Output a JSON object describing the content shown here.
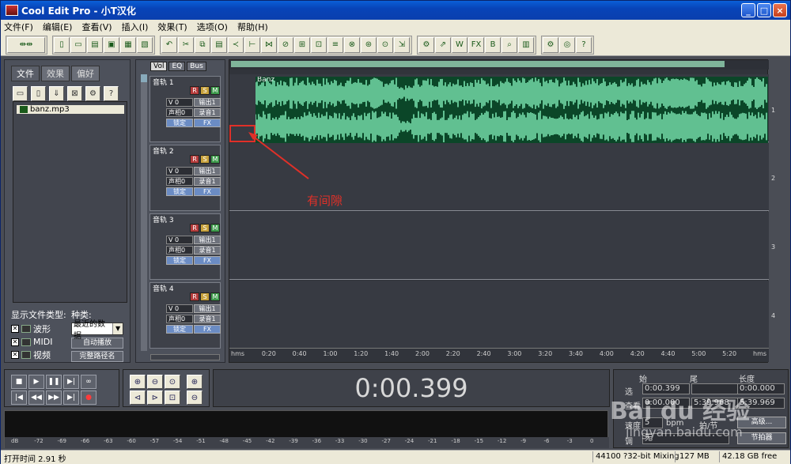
{
  "window": {
    "title": "Cool Edit Pro   - 小T汉化",
    "minimize": "_",
    "maximize": "□",
    "close": "×"
  },
  "menu": [
    "文件(F)",
    "编辑(E)",
    "查看(V)",
    "插入(I)",
    "效果(T)",
    "选项(O)",
    "帮助(H)"
  ],
  "left_panel": {
    "tabs": [
      "文件",
      "效果",
      "偏好"
    ],
    "files": [
      "banz.mp3"
    ],
    "file_type_label": "显示文件类型:",
    "types": [
      {
        "label": "波形",
        "checked": true
      },
      {
        "label": "MIDI",
        "checked": true
      },
      {
        "label": "视频",
        "checked": true
      }
    ],
    "kind_label": "种类:",
    "kind_value": "最近的数据",
    "auto_play": "自动播放",
    "full_path": "完整路径名"
  },
  "track_panel": {
    "tabs": [
      "Vol",
      "EQ",
      "Bus"
    ],
    "tracks": [
      {
        "name": "音轨 1",
        "vol": "V 0",
        "pan": "声相0",
        "out": "输出1",
        "rec": "录音1",
        "lock": "锁定",
        "fx": "FX"
      },
      {
        "name": "音轨 2",
        "vol": "V 0",
        "pan": "声相0",
        "out": "输出1",
        "rec": "录音1",
        "lock": "锁定",
        "fx": "FX"
      },
      {
        "name": "音轨 3",
        "vol": "V 0",
        "pan": "声相0",
        "out": "输出1",
        "rec": "录音1",
        "lock": "锁定",
        "fx": "FX"
      },
      {
        "name": "音轨 4",
        "vol": "V 0",
        "pan": "声相0",
        "out": "输出1",
        "rec": "录音1",
        "lock": "锁定",
        "fx": "FX"
      }
    ],
    "rsm": [
      "R",
      "S",
      "M"
    ]
  },
  "wave": {
    "clip_name": "Banz",
    "annotation": "有间隙",
    "timeline": [
      "hms",
      "0:20",
      "0:40",
      "1:00",
      "1:20",
      "1:40",
      "2:00",
      "2:20",
      "2:40",
      "3:00",
      "3:20",
      "3:40",
      "4:00",
      "4:20",
      "4:40",
      "5:00",
      "5:20",
      "hms"
    ],
    "track_numbers": [
      "1",
      "2",
      "3",
      "4"
    ]
  },
  "time_display": "0:00.399",
  "selection": {
    "header_start": "始",
    "header_end": "尾",
    "header_length": "长度",
    "row_sel": "选",
    "row_view": "查看",
    "sel_start": "0:00.399",
    "sel_end": "",
    "sel_length": "0:00.000",
    "view_start": "0:00.000",
    "view_end": "5:39.968",
    "view_length": "5:39.969",
    "advanced": "高级...",
    "tempo_label": "速度",
    "tempo_value": "5",
    "bpm": "bpm",
    "beat_label": "拍/节",
    "key_label": "调",
    "key_value": "无",
    "rhythm": "节拍器"
  },
  "level_meter": {
    "ticks": [
      "dB",
      "-72",
      "-69",
      "-66",
      "-63",
      "-60",
      "-57",
      "-54",
      "-51",
      "-48",
      "-45",
      "-42",
      "-39",
      "-36",
      "-33",
      "-30",
      "-27",
      "-24",
      "-21",
      "-18",
      "-15",
      "-12",
      "-9",
      "-6",
      "-3",
      "0"
    ]
  },
  "status": {
    "open_time": "打开时间  2.91 秒",
    "format": "44100 ?32-bit Mixing",
    "memory": "127 MB",
    "free": "42.18 GB free"
  },
  "watermark": {
    "brand": "Bai du 经验",
    "url": "jingyan.baidu.com"
  },
  "colors": {
    "waveform": "#7ee8b4",
    "clip_bg": "#0b4628",
    "annotation": "#e03028",
    "title_bar": "#0a4fc8"
  }
}
